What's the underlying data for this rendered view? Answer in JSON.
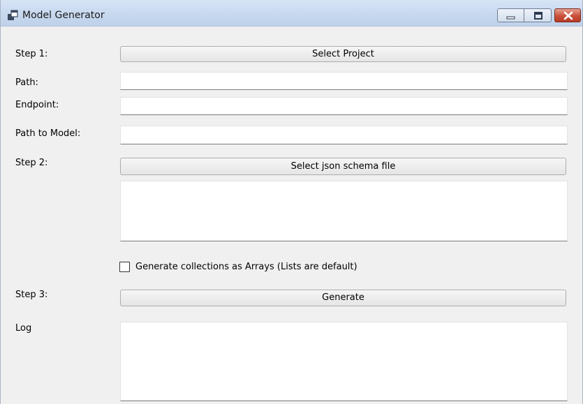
{
  "window": {
    "title": "Model Generator",
    "icons": {
      "app": "app-window-icon",
      "minimize": "minimize-icon",
      "maximize": "maximize-icon",
      "close": "close-icon"
    },
    "colors": {
      "titlebar": "#c6d7ee",
      "close": "#c9503a",
      "body": "#f0f0f0"
    }
  },
  "step1": {
    "label": "Step 1:",
    "button": "Select Project"
  },
  "path": {
    "label": "Path:",
    "value": ""
  },
  "endpoint": {
    "label": "Endpoint:",
    "value": ""
  },
  "path_to_model": {
    "label": "Path to Model:",
    "value": ""
  },
  "step2": {
    "label": "Step 2:",
    "button": "Select json schema file",
    "schema_text": ""
  },
  "arrays_option": {
    "label": "Generate collections as Arrays (Lists are default)",
    "checked": false
  },
  "step3": {
    "label": "Step 3:",
    "button": "Generate"
  },
  "log": {
    "label": "Log",
    "text": ""
  }
}
